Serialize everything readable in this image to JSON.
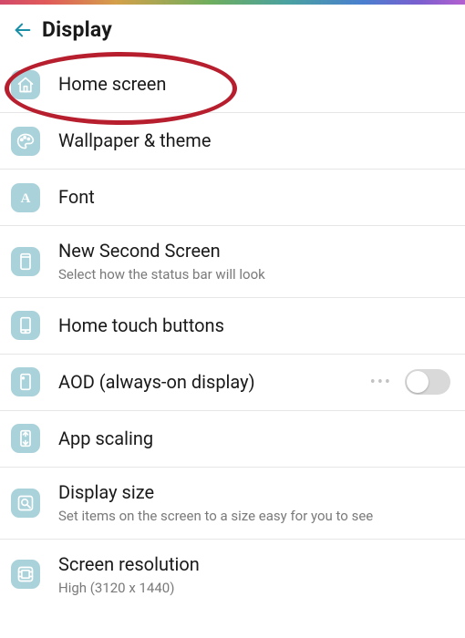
{
  "header": {
    "title": "Display"
  },
  "items": {
    "home_screen": {
      "label": "Home screen"
    },
    "wallpaper": {
      "label": "Wallpaper & theme"
    },
    "font": {
      "label": "Font"
    },
    "second_screen": {
      "label": "New Second Screen",
      "sub": "Select how the status bar will look"
    },
    "home_touch": {
      "label": "Home touch buttons"
    },
    "aod": {
      "label": "AOD (always-on display)",
      "toggle": false
    },
    "app_scaling": {
      "label": "App scaling"
    },
    "display_size": {
      "label": "Display size",
      "sub": "Set items on the screen to a size easy for you to see"
    },
    "screen_res": {
      "label": "Screen resolution",
      "sub": "High (3120 x 1440)"
    }
  }
}
